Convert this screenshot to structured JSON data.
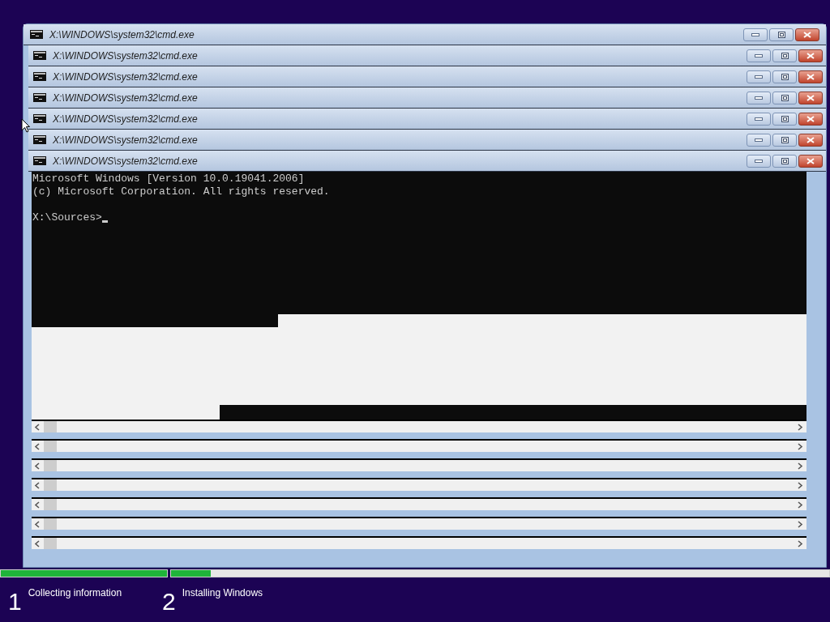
{
  "windows": [
    {
      "title": "X:\\WINDOWS\\system32\\cmd.exe"
    },
    {
      "title": "X:\\WINDOWS\\system32\\cmd.exe"
    },
    {
      "title": "X:\\WINDOWS\\system32\\cmd.exe"
    },
    {
      "title": "X:\\WINDOWS\\system32\\cmd.exe"
    },
    {
      "title": "X:\\WINDOWS\\system32\\cmd.exe"
    },
    {
      "title": "X:\\WINDOWS\\system32\\cmd.exe"
    },
    {
      "title": "X:\\WINDOWS\\system32\\cmd.exe"
    }
  ],
  "console": {
    "lines": [
      "Microsoft Windows [Version 10.0.19041.2006]",
      "(c) Microsoft Corporation. All rights reserved."
    ],
    "prompt": "X:\\Sources>"
  },
  "steps": [
    {
      "number": "1",
      "label": "Collecting information",
      "level": 1
    },
    {
      "number": "2",
      "label": "Installing Windows",
      "level": 0.06
    }
  ]
}
